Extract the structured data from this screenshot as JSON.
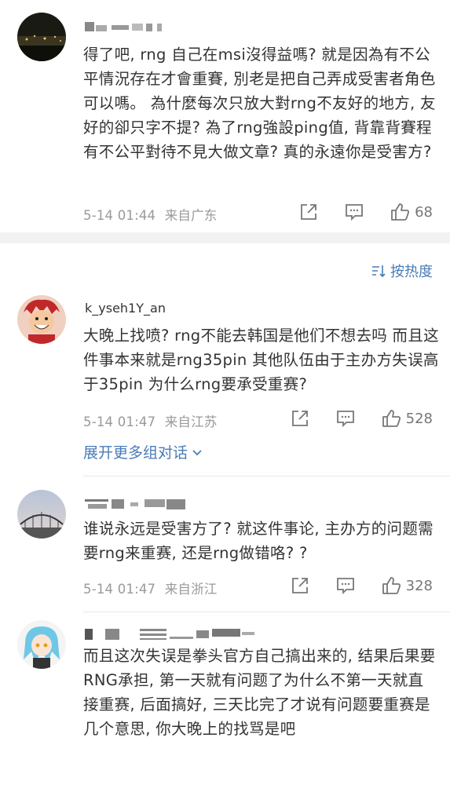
{
  "comments": [
    {
      "text": "得了吧, rng 自己在msi沒得益嗎? 就是因為有不公平情況存在才會重賽, 別老是把自己弄成受害者角色可以嗎。 為什麼每次只放大對rng不友好的地方, 友好的卻只字不提? 為了rng強設ping值, 背靠背賽程 有不公平對待不見大做文章? 真的永遠你是受害方?",
      "time": "5-14 01:44",
      "location": "来自广东",
      "likes": "68"
    },
    {
      "username": "k_yseh1Y_an",
      "text": "大晚上找喷? rng不能去韩国是他们不想去吗 而且这件事本来就是rng35pin 其他队伍由于主办方失误高于35pin 为什么rng要承受重赛?",
      "time": "5-14 01:47",
      "location": "来自江苏",
      "likes": "528",
      "expand_label": "展开更多组对话"
    },
    {
      "text": "谁说永远是受害方了? 就这件事论, 主办方的问题需要rng来重赛, 还是rng做错咯? ?",
      "time": "5-14 01:47",
      "location": "来自浙江",
      "likes": "328"
    },
    {
      "text": "而且这次失误是拳头官方自己搞出来的, 结果后果要RNG承担, 第一天就有问题了为什么不第一天就直接重赛, 后面搞好, 三天比完了才说有问题要重赛是几个意思, 你大晚上的找骂是吧"
    }
  ],
  "sort_label": "按热度",
  "icons": [
    "share-icon",
    "comment-icon",
    "like-icon",
    "sort-icon",
    "chevron-down-icon"
  ],
  "colors": {
    "link": "#4a7bb7",
    "meta": "#999999",
    "divider": "#f2f2f2"
  }
}
